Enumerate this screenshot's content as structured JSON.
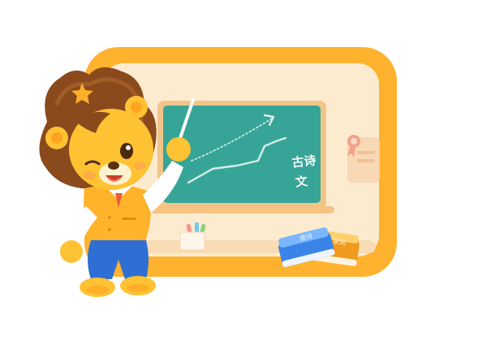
{
  "board": {
    "text_line1": "古诗",
    "text_line2": "文"
  },
  "books": {
    "blue_title": "唐诗",
    "orange_title": "宋词"
  },
  "colors": {
    "frame": "#ffb22e",
    "frame_inner": "#fdebd0",
    "chalkboard": "#36a597",
    "chalkboard_rim": "#f1c58a",
    "lion_fur": "#ffc233",
    "lion_mane": "#8a4a1c",
    "vest": "#ffb32a",
    "pants": "#2f6fd3",
    "book_blue": "#3a84e8",
    "book_orange": "#f09a1e"
  },
  "icons": [
    "medal-icon",
    "chalk-arrow-icon",
    "pointer-stick-icon",
    "chalk-cup-icon"
  ]
}
